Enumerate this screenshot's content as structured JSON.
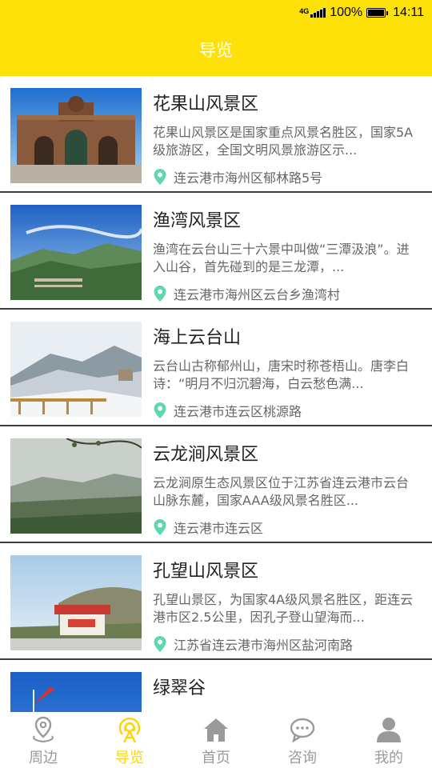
{
  "status": {
    "network": "4G",
    "battery": "100%",
    "time": "14:11"
  },
  "header": {
    "title": "导览"
  },
  "accent_color": "#FFE10A",
  "list": [
    {
      "title": "花果山风景区",
      "desc": "花果山风景区是国家重点风景名胜区，国家5A级旅游区，全国文明风景旅游区示...",
      "location": "连云港市海州区郁林路5号"
    },
    {
      "title": "渔湾风景区",
      "desc": "渔湾在云台山三十六景中叫做“三潭汲浪”。进入山谷，首先碰到的是三龙潭，...",
      "location": "连云港市海州区云台乡渔湾村"
    },
    {
      "title": "海上云台山",
      "desc": "云台山古称郁州山，唐宋时称苍梧山。唐李白诗：“明月不归沉碧海，白云愁色满...",
      "location": "连云港市连云区桃源路"
    },
    {
      "title": "云龙涧风景区",
      "desc": "云龙涧原生态风景区位于江苏省连云港市云台山脉东麓，国家AAA级风景名胜区...",
      "location": "连云港市连云区"
    },
    {
      "title": "孔望山风景区",
      "desc": "孔望山景区，为国家4A级风景名胜区，距连云港市区2.5公里，因孔子登山望海而...",
      "location": "江苏省连云港市海州区盐河南路"
    },
    {
      "title": "绿翠谷",
      "desc": "",
      "location": ""
    }
  ],
  "tabs": [
    {
      "label": "周边",
      "icon": "location-pin-icon"
    },
    {
      "label": "导览",
      "icon": "guide-signal-icon",
      "active": true
    },
    {
      "label": "首页",
      "icon": "home-icon"
    },
    {
      "label": "咨询",
      "icon": "chat-bubble-icon"
    },
    {
      "label": "我的",
      "icon": "user-icon"
    }
  ]
}
